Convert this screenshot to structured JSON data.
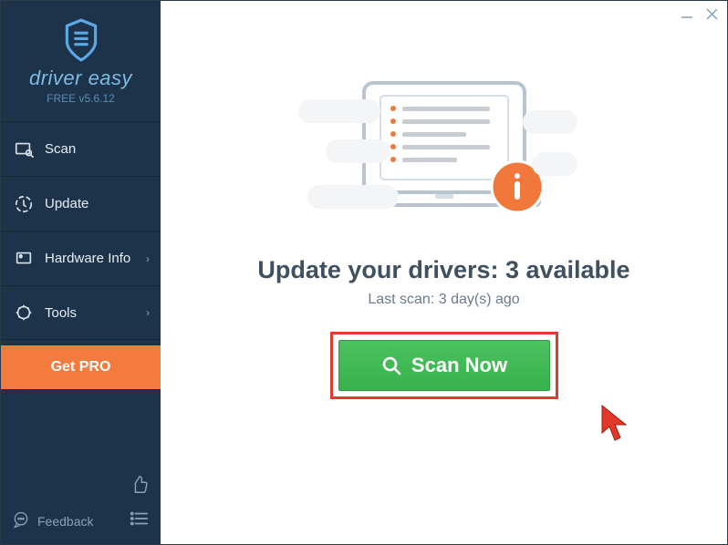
{
  "brand": {
    "name": "driver easy",
    "tagline": "FREE v5.6.12"
  },
  "sidebar": {
    "items": [
      {
        "label": "Scan",
        "icon": "scan",
        "arrow": false
      },
      {
        "label": "Update",
        "icon": "update",
        "arrow": false
      },
      {
        "label": "Hardware Info",
        "icon": "hardware",
        "arrow": true
      },
      {
        "label": "Tools",
        "icon": "tools",
        "arrow": true
      }
    ],
    "get_pro_label": "Get PRO",
    "feedback_label": "Feedback"
  },
  "main": {
    "title": "Update your drivers: 3 available",
    "subtitle": "Last scan: 3 day(s) ago",
    "scan_button_label": "Scan Now"
  }
}
